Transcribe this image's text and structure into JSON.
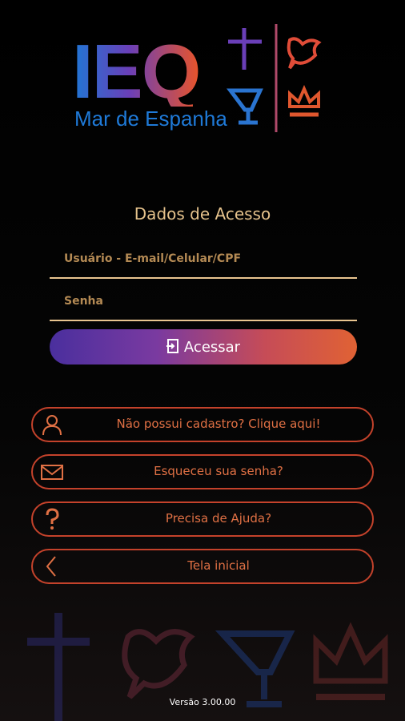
{
  "logo": {
    "main_text": "IEQ",
    "subtitle": "Mar de Espanha"
  },
  "login": {
    "title": "Dados de Acesso",
    "user_placeholder": "Usuário - E-mail/Celular/CPF",
    "password_placeholder": "Senha",
    "submit_label": "Acessar"
  },
  "options": [
    {
      "label": "Não possui cadastro? Clique aqui!",
      "icon": "user-icon"
    },
    {
      "label": "Esqueceu sua senha?",
      "icon": "mail-icon"
    },
    {
      "label": "Precisa de Ajuda?",
      "icon": "question-icon"
    },
    {
      "label": "Tela inicial",
      "icon": "chevron-left-icon"
    }
  ],
  "footer": {
    "version": "Versão 3.00.00"
  },
  "colors": {
    "accent_gold": "#e9c590",
    "accent_orange": "#c4422b",
    "brand_blue": "#1f7ad8",
    "gradient_start": "#4a2f9e",
    "gradient_end": "#e06234"
  }
}
